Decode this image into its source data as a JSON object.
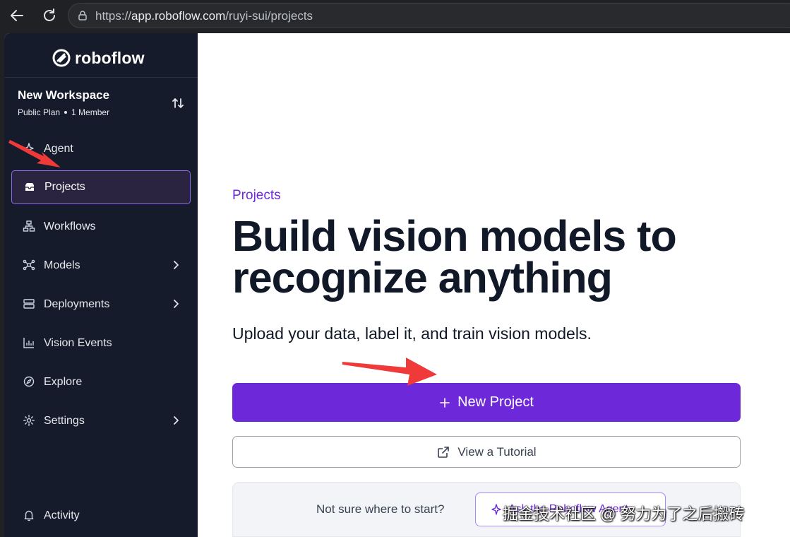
{
  "browser": {
    "url_prefix": "https://",
    "url_domain": "app.roboflow.com",
    "url_path": "/ruyi-sui/projects",
    "icons": [
      "back-arrow-icon",
      "reload-icon",
      "lock-icon"
    ]
  },
  "sidebar": {
    "logo": "roboflow",
    "workspace": {
      "name": "New Workspace",
      "plan": "Public Plan",
      "members": "1 Member"
    },
    "items": [
      {
        "label": "Agent",
        "icon": "sparkle-icon",
        "active": false,
        "chevron": false
      },
      {
        "label": "Projects",
        "icon": "inbox-icon",
        "active": true,
        "chevron": false
      },
      {
        "label": "Workflows",
        "icon": "workflow-icon",
        "active": false,
        "chevron": false
      },
      {
        "label": "Models",
        "icon": "network-icon",
        "active": false,
        "chevron": true
      },
      {
        "label": "Deployments",
        "icon": "server-icon",
        "active": false,
        "chevron": true
      },
      {
        "label": "Vision Events",
        "icon": "bar-chart-icon",
        "active": false,
        "chevron": false
      },
      {
        "label": "Explore",
        "icon": "compass-icon",
        "active": false,
        "chevron": false
      },
      {
        "label": "Settings",
        "icon": "gear-icon",
        "active": false,
        "chevron": true
      }
    ],
    "activity": {
      "label": "Activity",
      "icon": "bell-icon"
    }
  },
  "main": {
    "eyebrow": "Projects",
    "headline": "Build vision models to recognize anything",
    "subhead": "Upload your data, label it, and train vision models.",
    "new_project_label": "New Project",
    "tutorial_label": "View a Tutorial",
    "helper_question": "Not sure where to start?",
    "helper_button_label": "Ask the Roboflow Agent"
  },
  "overlay": {
    "watermark": "掘金技术社区 @ 努力为了之后搬砖"
  },
  "colors": {
    "sidebar_bg": "#161b2c",
    "accent": "#6d28d9",
    "active_border": "#8b6cf0",
    "annotation_arrow": "#f03a3a"
  }
}
